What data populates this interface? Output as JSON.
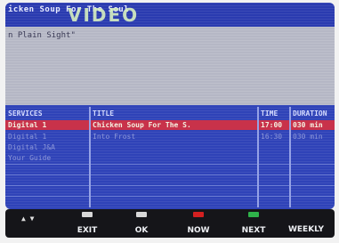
{
  "topbar": {
    "title": "icken Soup For The Soul",
    "badge": "VIDEO"
  },
  "description": {
    "text": "n Plain Sight\""
  },
  "guide": {
    "columns": {
      "services": "SERVICES",
      "title": "TITLE",
      "time": "TIME",
      "duration": "DURATION"
    },
    "rows": [
      {
        "service": "Digital 1",
        "title": "Chicken Soup For The S.",
        "time": "17:00",
        "duration": "030 min",
        "selected": true
      },
      {
        "service": "Digital 1",
        "title": "Into Frost",
        "time": "16:30",
        "duration": "030 min",
        "selected": false
      },
      {
        "service": "Digital J&A",
        "title": "",
        "time": "",
        "duration": "",
        "selected": false
      },
      {
        "service": "Your Guide",
        "title": "",
        "time": "",
        "duration": "",
        "selected": false
      }
    ]
  },
  "footer": {
    "arrows": "▲ ▼",
    "buttons": [
      {
        "label": "EXIT",
        "color": "#d8d8d8"
      },
      {
        "label": "OK",
        "color": "#d8d8d8"
      },
      {
        "label": "NOW",
        "color": "#d42020"
      },
      {
        "label": "NEXT",
        "color": "#2fb24a"
      },
      {
        "label": "WEEKLY",
        "color": ""
      }
    ]
  }
}
